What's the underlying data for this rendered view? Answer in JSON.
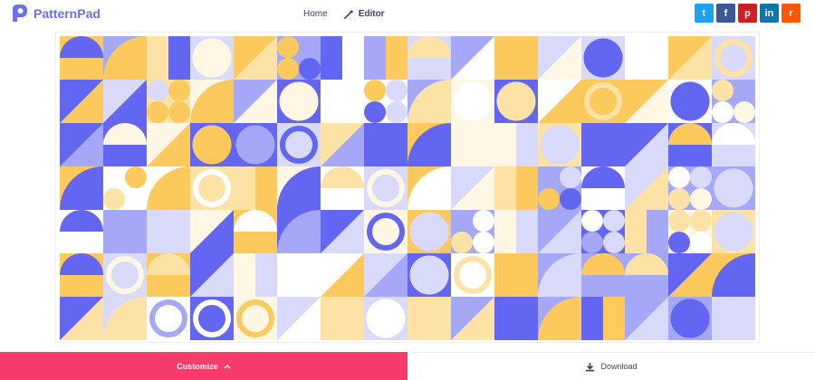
{
  "header": {
    "brand": "PatternPad",
    "nav": [
      {
        "label": "Home",
        "active": false
      },
      {
        "label": "Editor",
        "active": true,
        "icon": "magic-wand-icon"
      }
    ],
    "social": [
      {
        "name": "twitter",
        "glyph": "t",
        "color": "#1da1f2"
      },
      {
        "name": "facebook",
        "glyph": "f",
        "color": "#3b5998"
      },
      {
        "name": "pinterest",
        "glyph": "p",
        "color": "#cb2027"
      },
      {
        "name": "linkedin",
        "glyph": "in",
        "color": "#0e76a8"
      },
      {
        "name": "reddit",
        "glyph": "r",
        "color": "#ff5700"
      }
    ]
  },
  "pattern": {
    "palette": [
      "#6366f1",
      "#a5a8f7",
      "#d9daf9",
      "#fbc95c",
      "#fde2a6",
      "#fff6e3",
      "#ffffff"
    ]
  },
  "footer": {
    "customize_label": "Customize",
    "download_label": "Download"
  }
}
